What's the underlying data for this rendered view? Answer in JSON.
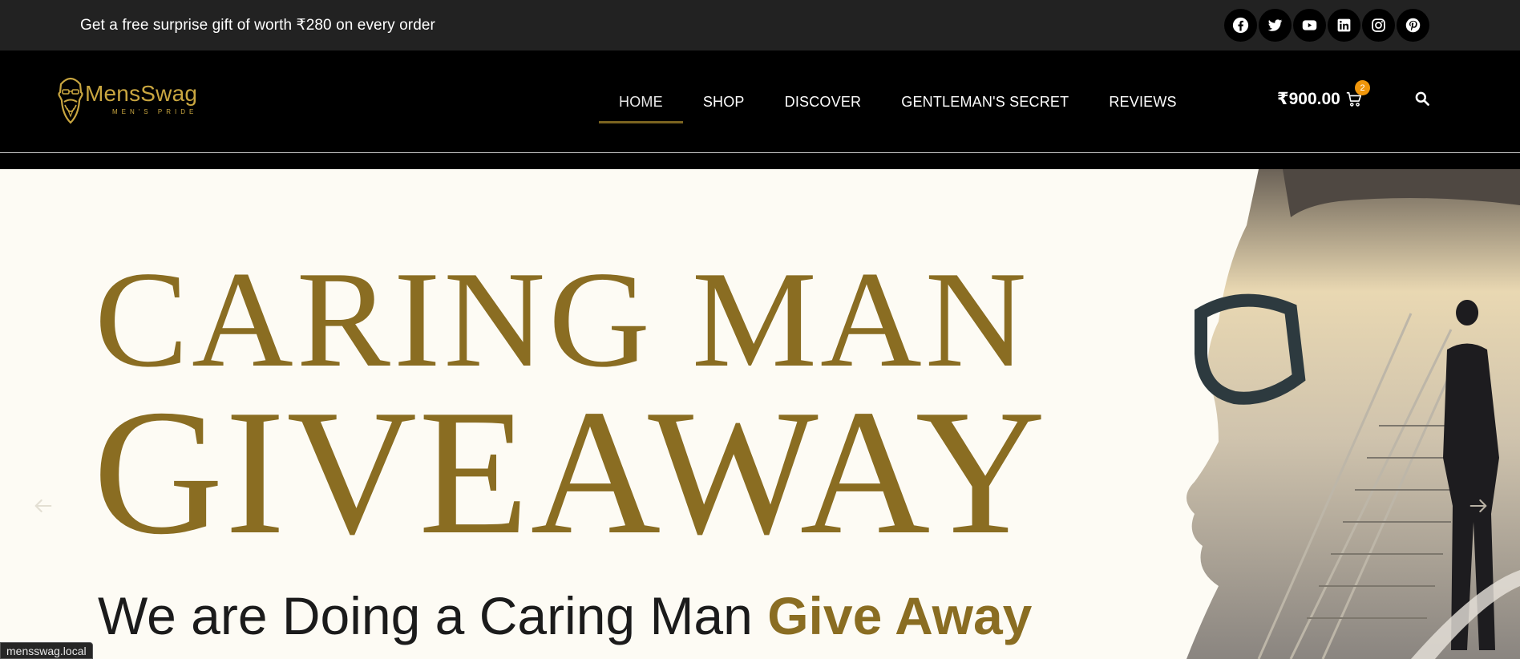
{
  "topbar": {
    "promo_text": "Get a free surprise gift of worth ₹280 on every order",
    "social_icons": [
      "facebook-icon",
      "twitter-icon",
      "youtube-icon",
      "linkedin-icon",
      "instagram-icon",
      "pinterest-icon"
    ]
  },
  "header": {
    "logo_text": "MensSwag",
    "logo_tagline": "MEN'S PRIDE",
    "nav": [
      "HOME",
      "SHOP",
      "DISCOVER",
      "GENTLEMAN'S SECRET",
      "REVIEWS"
    ],
    "active_nav": "HOME",
    "cart_amount": "₹900.00",
    "cart_count": "2"
  },
  "hero": {
    "line1": "CARING MAN",
    "line2": "GIVEAWAY",
    "line3_plain": "We are Doing a Caring Man ",
    "line3_bold": "Give Away"
  },
  "status_url": "mensswag.local",
  "colors": {
    "gold": "#8a6d22",
    "logo_gold": "#c9a640",
    "badge": "#f0960b",
    "topbar_bg": "#222222",
    "header_bg": "#000000",
    "hero_bg": "#fdfbf4"
  }
}
